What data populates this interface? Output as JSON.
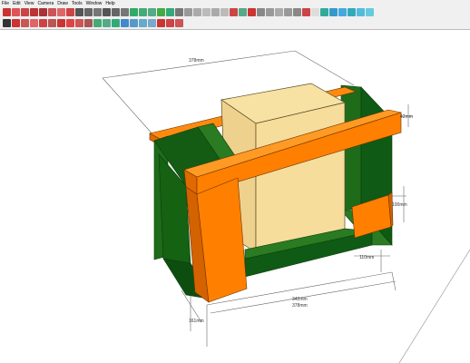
{
  "menu": [
    "File",
    "Edit",
    "View",
    "Camera",
    "Draw",
    "Tools",
    "Window",
    "Help"
  ],
  "dimensions": {
    "top_width": "378mm",
    "right_height": "100mm",
    "right_small": "110mm",
    "inner_width": "342mm",
    "outer_width": "378mm",
    "left_height": "161mm",
    "top_right_small": "42mm"
  },
  "colors": {
    "orange": "#ff7f00",
    "green": "#0f6e16",
    "box": "#f7dea0",
    "background": "#ffffff",
    "toolbar": "#f0f0f0"
  }
}
